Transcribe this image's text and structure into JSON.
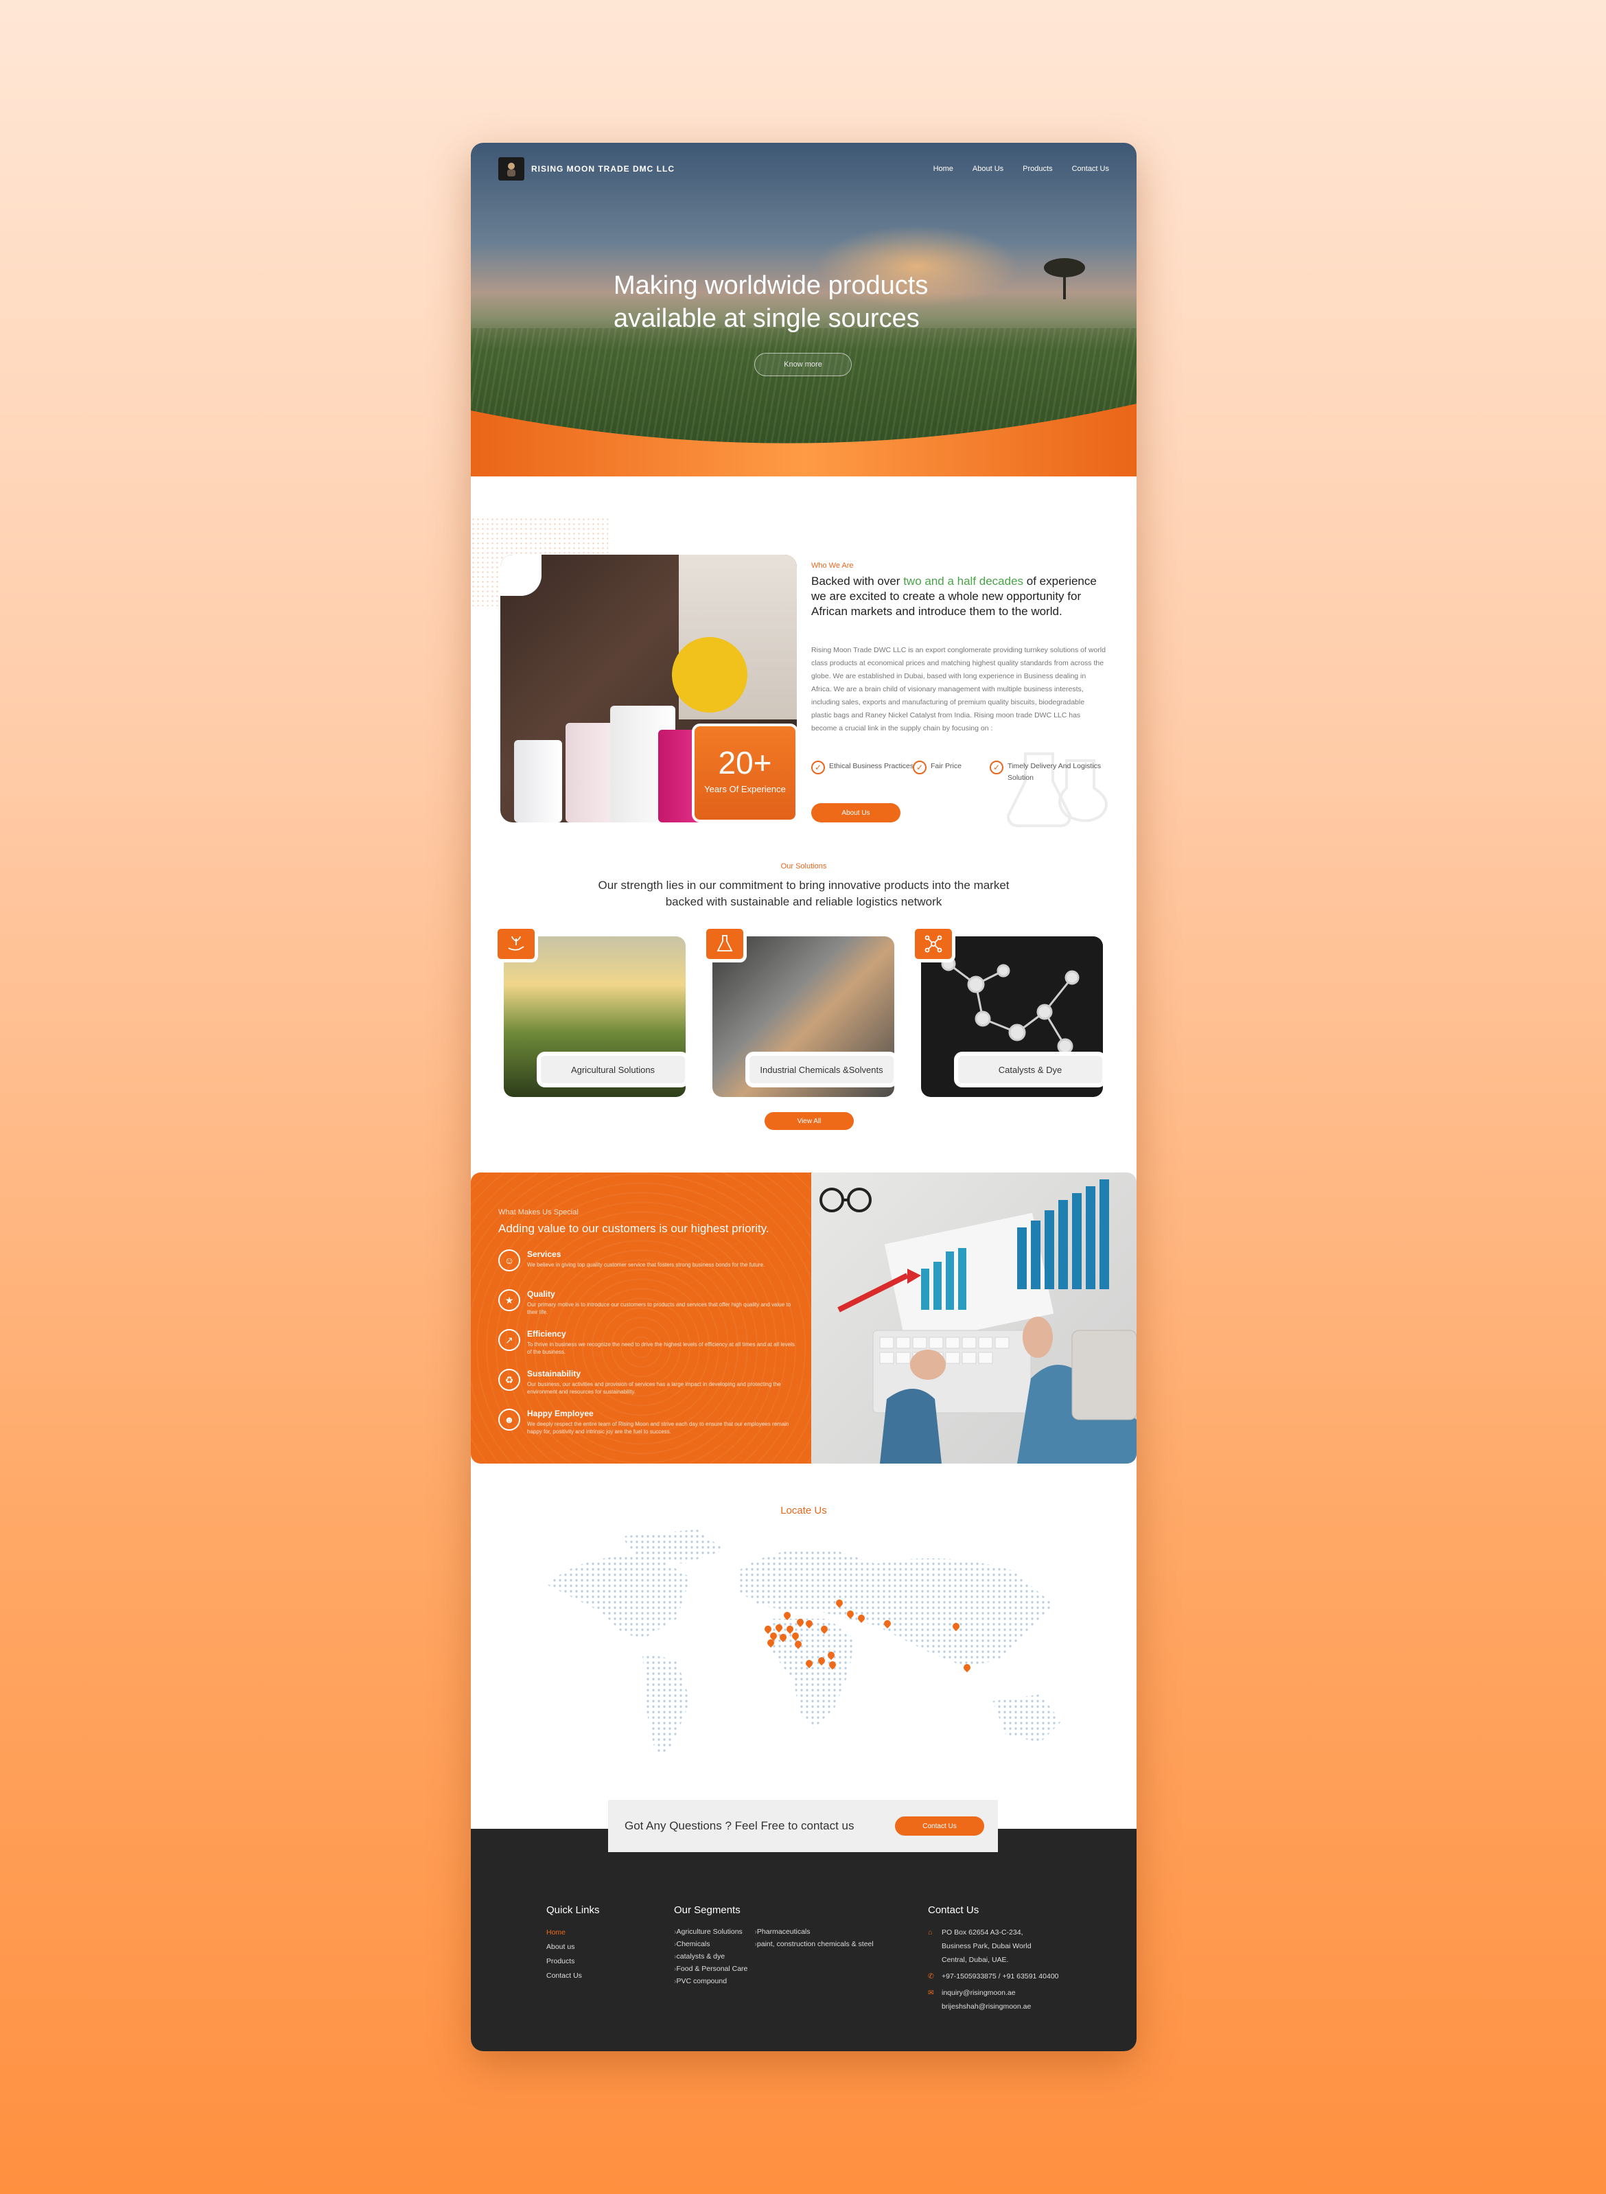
{
  "nav": {
    "brand": "RISING MOON TRADE DMC LLC",
    "links": [
      "Home",
      "About Us",
      "Products",
      "Contact Us"
    ]
  },
  "hero": {
    "title_line1": "Making worldwide products",
    "title_line2": "available at single sources",
    "button": "Know more"
  },
  "about": {
    "tag": "Who We Are",
    "head_pre": "Backed with over ",
    "head_highlight": "two and a half decades",
    "head_post": " of experience we are excited to create a whole new opportunity for African markets and introduce them to the world.",
    "body": "Rising Moon Trade DWC LLC is an export conglomerate providing turnkey solutions of world class products at economical prices and matching highest quality standards from across the globe. We are established in Dubai, based with long experience in Business dealing in Africa. We are a brain child of visionary management with multiple business interests, including sales, exports and manufacturing of premium quality biscuits, biodegradable plastic bags and Raney Nickel Catalyst from India. Rising moon trade DWC LLC has become a crucial link in the supply chain by focusing on :",
    "experience_number": "20+",
    "experience_label": "Years Of Experience",
    "features": [
      "Ethical Business Practices",
      "Fair Price",
      "Timely Delivery And Logistics Solution"
    ],
    "button": "About Us"
  },
  "solutions": {
    "tag": "Our Solutions",
    "head": "Our strength lies in our commitment to bring innovative products into the market backed with sustainable and reliable logistics network",
    "cards": [
      {
        "label": "Agricultural Solutions",
        "icon": "plant-hand-icon"
      },
      {
        "label": "Industrial Chemicals &Solvents",
        "icon": "flask-icon"
      },
      {
        "label": "Catalysts & Dye",
        "icon": "molecule-icon"
      }
    ],
    "button": "View All"
  },
  "special": {
    "tag": "What Makes Us Special",
    "head": "Adding value to our customers is our highest priority.",
    "items": [
      {
        "title": "Services",
        "desc": "We believe in giving top quality customer service that fosters strong business bonds for the future.",
        "icon": "service-icon"
      },
      {
        "title": "Quality",
        "desc": "Our primary motive is to introduce our customers to products and services that offer high quality and value to their life.",
        "icon": "quality-icon"
      },
      {
        "title": "Efficiency",
        "desc": "To thrive in business we recognize the need to drive the highest levels of efficiency at all times and at all levels of the business.",
        "icon": "efficiency-icon"
      },
      {
        "title": "Sustainability",
        "desc": "Our business, our activities and provision of services has a large impact in developing and protecting the environment and resources for sustainability.",
        "icon": "sustainability-icon"
      },
      {
        "title": "Happy Employee",
        "desc": "We deeply respect the entire team of Rising Moon and strive each day to ensure that our employees remain happy for, positivity and intrinsic joy are the fuel to success.",
        "icon": "employees-icon"
      }
    ]
  },
  "locate": {
    "tag": "Locate Us"
  },
  "cta": {
    "text": "Got Any Questions ? Feel Free to contact us",
    "button": "Contact Us"
  },
  "footer": {
    "quick_links_head": "Quick Links",
    "quick_links": [
      "Home",
      "About us",
      "Products",
      "Contact Us"
    ],
    "segments_head": "Our Segments",
    "segments_col1": [
      "Agriculture Solutions",
      "Chemicals",
      "catalysts & dye",
      "Food & Personal Care",
      "PVC compound"
    ],
    "segments_col2": [
      "Pharmaceuticals",
      "paint, construction chemicals & steel"
    ],
    "contact_head": "Contact Us",
    "address_line1": "PO Box 62654 A3-C-234,",
    "address_line2": "Business Park, Dubai World",
    "address_line3": "Central, Dubai, UAE.",
    "phone": "+97-1505933875 / +91 63591 40400",
    "email1": "inquiry@risingmoon.ae",
    "email2": "brijeshshah@risingmoon.ae"
  },
  "colors": {
    "accent": "#ee6a18",
    "highlight": "#4aa34a",
    "footer": "#262626"
  }
}
